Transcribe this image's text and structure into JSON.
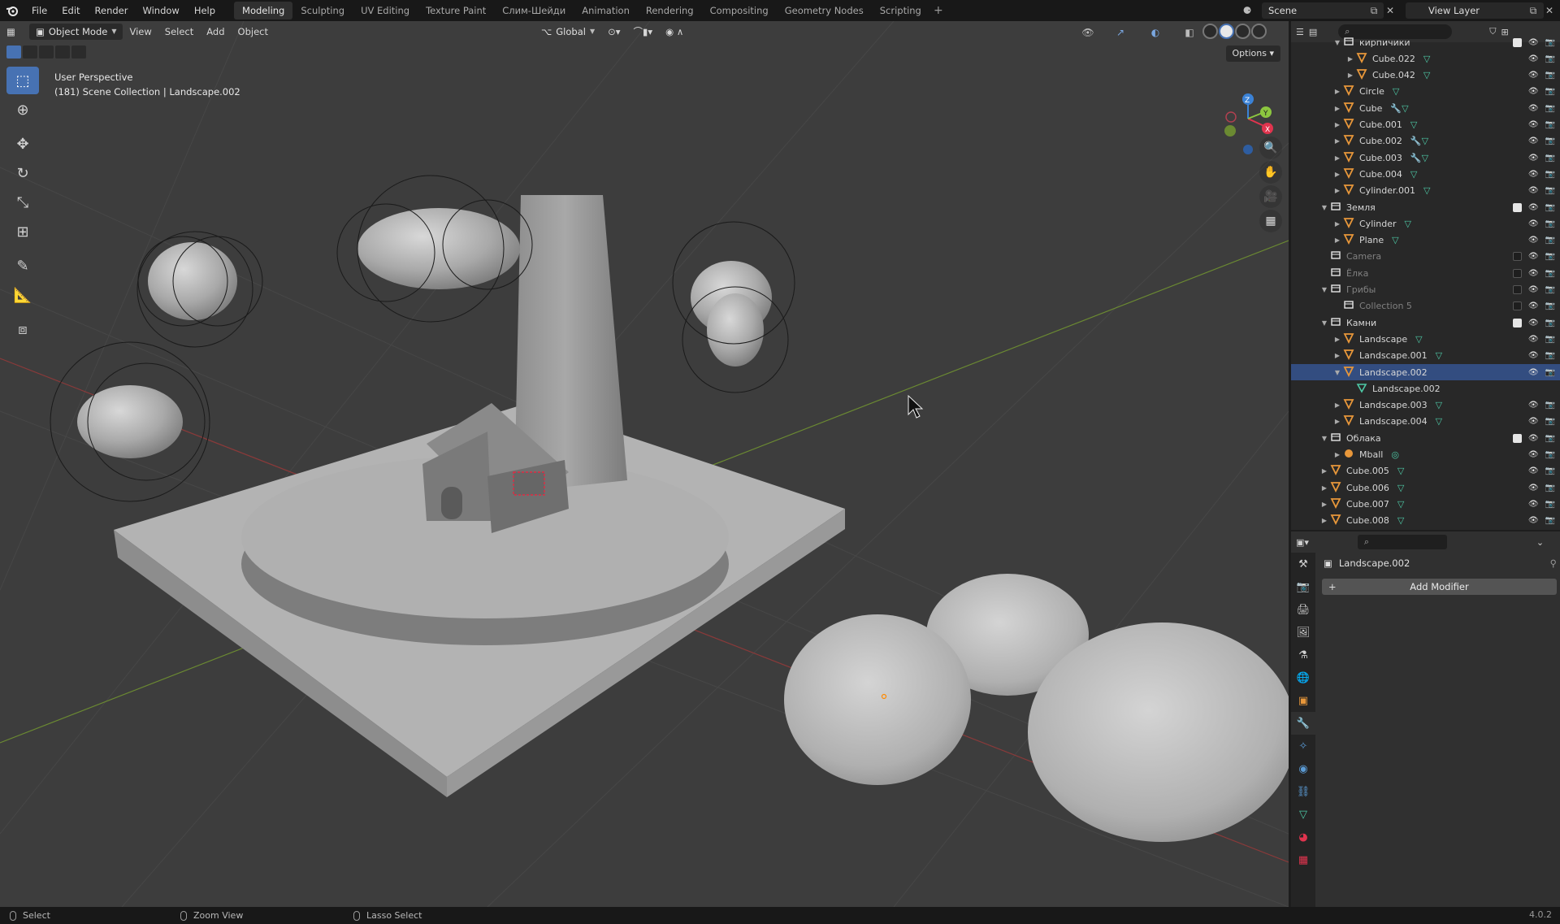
{
  "topbar": {
    "menus": [
      "File",
      "Edit",
      "Render",
      "Window",
      "Help"
    ],
    "workspaces": [
      "Modeling",
      "Sculpting",
      "UV Editing",
      "Texture Paint",
      "Слим-Шейди",
      "Animation",
      "Rendering",
      "Compositing",
      "Geometry Nodes",
      "Scripting"
    ],
    "active_workspace": "Modeling",
    "scene": "Scene",
    "view_layer": "View Layer"
  },
  "viewport": {
    "mode": "Object Mode",
    "menus": [
      "View",
      "Select",
      "Add",
      "Object"
    ],
    "orientation": "Global",
    "options_label": "Options",
    "info_line1": "User Perspective",
    "info_line2": "(181) Scene Collection | Landscape.002",
    "tools": [
      "select-box",
      "cursor",
      "move",
      "rotate",
      "scale",
      "transform",
      "annotate",
      "measure",
      "add-cube"
    ],
    "axis_colors": {
      "x": "#e0344e",
      "y": "#8cc63f",
      "z": "#3b82d6"
    }
  },
  "outliner": {
    "rows": [
      {
        "label": "кирпичики",
        "type": "collection",
        "indent": 2,
        "arrow": "open",
        "check": true
      },
      {
        "label": "Cube.022",
        "type": "mesh",
        "indent": 3,
        "arrow": "closed",
        "mod": false
      },
      {
        "label": "Cube.042",
        "type": "mesh",
        "indent": 3,
        "arrow": "closed",
        "mod": false
      },
      {
        "label": "Circle",
        "type": "mesh",
        "indent": 2,
        "arrow": "closed",
        "mod": false
      },
      {
        "label": "Cube",
        "type": "mesh",
        "indent": 2,
        "arrow": "closed",
        "mod": true
      },
      {
        "label": "Cube.001",
        "type": "mesh",
        "indent": 2,
        "arrow": "closed",
        "mod": false
      },
      {
        "label": "Cube.002",
        "type": "mesh",
        "indent": 2,
        "arrow": "closed",
        "mod": true
      },
      {
        "label": "Cube.003",
        "type": "mesh",
        "indent": 2,
        "arrow": "closed",
        "mod": true
      },
      {
        "label": "Cube.004",
        "type": "mesh",
        "indent": 2,
        "arrow": "closed",
        "mod": false
      },
      {
        "label": "Cylinder.001",
        "type": "mesh",
        "indent": 2,
        "arrow": "closed",
        "mod": false
      },
      {
        "label": "Земля",
        "type": "collection",
        "indent": 1,
        "arrow": "open",
        "check": true
      },
      {
        "label": "Cylinder",
        "type": "mesh",
        "indent": 2,
        "arrow": "closed",
        "mod": false
      },
      {
        "label": "Plane",
        "type": "mesh",
        "indent": 2,
        "arrow": "closed",
        "mod": false
      },
      {
        "label": "Camera",
        "type": "collection",
        "indent": 1,
        "arrow": "none",
        "check": false,
        "dim": true
      },
      {
        "label": "Ёлка",
        "type": "collection",
        "indent": 1,
        "arrow": "none",
        "check": false,
        "dim": true
      },
      {
        "label": "Грибы",
        "type": "collection",
        "indent": 1,
        "arrow": "open",
        "check": false,
        "dim": true
      },
      {
        "label": "Collection 5",
        "type": "collection",
        "indent": 2,
        "arrow": "none",
        "check": false,
        "dim": true
      },
      {
        "label": "Камни",
        "type": "collection",
        "indent": 1,
        "arrow": "open",
        "check": true
      },
      {
        "label": "Landscape",
        "type": "mesh",
        "indent": 2,
        "arrow": "closed",
        "mod": false
      },
      {
        "label": "Landscape.001",
        "type": "mesh",
        "indent": 2,
        "arrow": "closed",
        "mod": false
      },
      {
        "label": "Landscape.002",
        "type": "mesh",
        "indent": 2,
        "arrow": "open",
        "mod": false,
        "selected": true,
        "no_data": true
      },
      {
        "label": "Landscape.002",
        "type": "meshdata",
        "indent": 3,
        "arrow": "none",
        "no_data": true,
        "no_vis": true
      },
      {
        "label": "Landscape.003",
        "type": "mesh",
        "indent": 2,
        "arrow": "closed",
        "mod": false
      },
      {
        "label": "Landscape.004",
        "type": "mesh",
        "indent": 2,
        "arrow": "closed",
        "mod": false
      },
      {
        "label": "Облака",
        "type": "collection",
        "indent": 1,
        "arrow": "open",
        "check": true
      },
      {
        "label": "Mball",
        "type": "meta",
        "indent": 2,
        "arrow": "closed",
        "mod": false
      },
      {
        "label": "Cube.005",
        "type": "mesh",
        "indent": 1,
        "arrow": "closed",
        "mod": false
      },
      {
        "label": "Cube.006",
        "type": "mesh",
        "indent": 1,
        "arrow": "closed",
        "mod": false
      },
      {
        "label": "Cube.007",
        "type": "mesh",
        "indent": 1,
        "arrow": "closed",
        "mod": false
      },
      {
        "label": "Cube.008",
        "type": "mesh",
        "indent": 1,
        "arrow": "closed",
        "mod": false
      }
    ]
  },
  "properties": {
    "object_name": "Landscape.002",
    "add_modifier_label": "Add Modifier",
    "tabs": [
      "tool",
      "render",
      "output",
      "view-layer",
      "scene",
      "world",
      "object",
      "modifiers",
      "particles",
      "physics",
      "constraints",
      "data",
      "material",
      "texture"
    ],
    "active_tab": "modifiers"
  },
  "statusbar": {
    "select": "Select",
    "zoom": "Zoom View",
    "lasso": "Lasso Select",
    "version": "4.0.2"
  }
}
